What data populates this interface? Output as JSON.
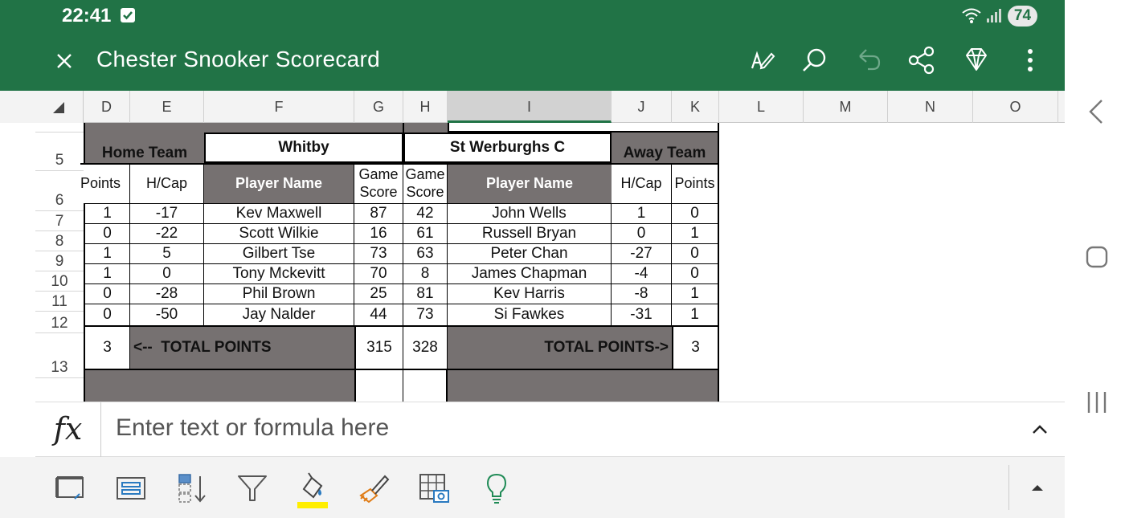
{
  "status_bar": {
    "time": "22:41",
    "battery": "74"
  },
  "app_bar": {
    "title": "Chester Snooker Scorecard"
  },
  "toolbar_icons": [
    "close-icon",
    "draw-pen-icon",
    "search-icon",
    "undo-icon",
    "share-icon",
    "premium-diamond-icon",
    "more-vertical-icon"
  ],
  "columns": [
    "D",
    "E",
    "F",
    "G",
    "H",
    "I",
    "J",
    "K",
    "L",
    "M",
    "N",
    "O"
  ],
  "selected_column": "I",
  "rows": [
    "5",
    "6",
    "7",
    "8",
    "9",
    "10",
    "11",
    "12",
    "13"
  ],
  "sheet": {
    "home_team_label": "Home Team",
    "away_team_label": "Away Team",
    "home_team": "Whitby",
    "away_team": "St Werburghs C",
    "headers": {
      "points_left": "Points",
      "hcap_left": "H/Cap",
      "player_left": "Player Name",
      "game_score_g": "Game Score",
      "game_score_h": "Game Score",
      "player_right": "Player Name",
      "hcap_right": "H/Cap",
      "points_right": "Points"
    },
    "players": [
      {
        "home_points": "1",
        "home_hcap": "-17",
        "home_name": "Kev Maxwell",
        "home_score": "87",
        "away_score": "42",
        "away_name": "John Wells",
        "away_hcap": "1",
        "away_points": "0"
      },
      {
        "home_points": "0",
        "home_hcap": "-22",
        "home_name": "Scott Wilkie",
        "home_score": "16",
        "away_score": "61",
        "away_name": "Russell Bryan",
        "away_hcap": "0",
        "away_points": "1"
      },
      {
        "home_points": "1",
        "home_hcap": "5",
        "home_name": "Gilbert Tse",
        "home_score": "73",
        "away_score": "63",
        "away_name": "Peter Chan",
        "away_hcap": "-27",
        "away_points": "0"
      },
      {
        "home_points": "1",
        "home_hcap": "0",
        "home_name": "Tony Mckevitt",
        "home_score": "70",
        "away_score": "8",
        "away_name": "James Chapman",
        "away_hcap": "-4",
        "away_points": "0"
      },
      {
        "home_points": "0",
        "home_hcap": "-28",
        "home_name": "Phil Brown",
        "home_score": "25",
        "away_score": "81",
        "away_name": "Kev Harris",
        "away_hcap": "-8",
        "away_points": "1"
      },
      {
        "home_points": "0",
        "home_hcap": "-50",
        "home_name": "Jay Nalder",
        "home_score": "44",
        "away_score": "73",
        "away_name": "Si Fawkes",
        "away_hcap": "-31",
        "away_points": "1"
      }
    ],
    "totals": {
      "home_points": "3",
      "home_label": "<--  TOTAL POINTS",
      "home_score": "315",
      "away_score": "328",
      "away_label": "TOTAL POINTS->",
      "away_points": "3"
    }
  },
  "formula_bar": {
    "fx_label": "fx",
    "placeholder": "Enter text or formula here"
  },
  "bottom_toolbar_icons": [
    "freeze-panes-icon",
    "wrap-text-icon",
    "sort-icon",
    "filter-icon",
    "fill-color-icon",
    "format-painter-icon",
    "insert-picture-table-icon",
    "ideas-lightbulb-icon",
    "collapse-arrow-icon"
  ],
  "colors": {
    "brand_green": "#217346",
    "header_fill": "#767171",
    "fill_color_underline": "#ffee00"
  }
}
